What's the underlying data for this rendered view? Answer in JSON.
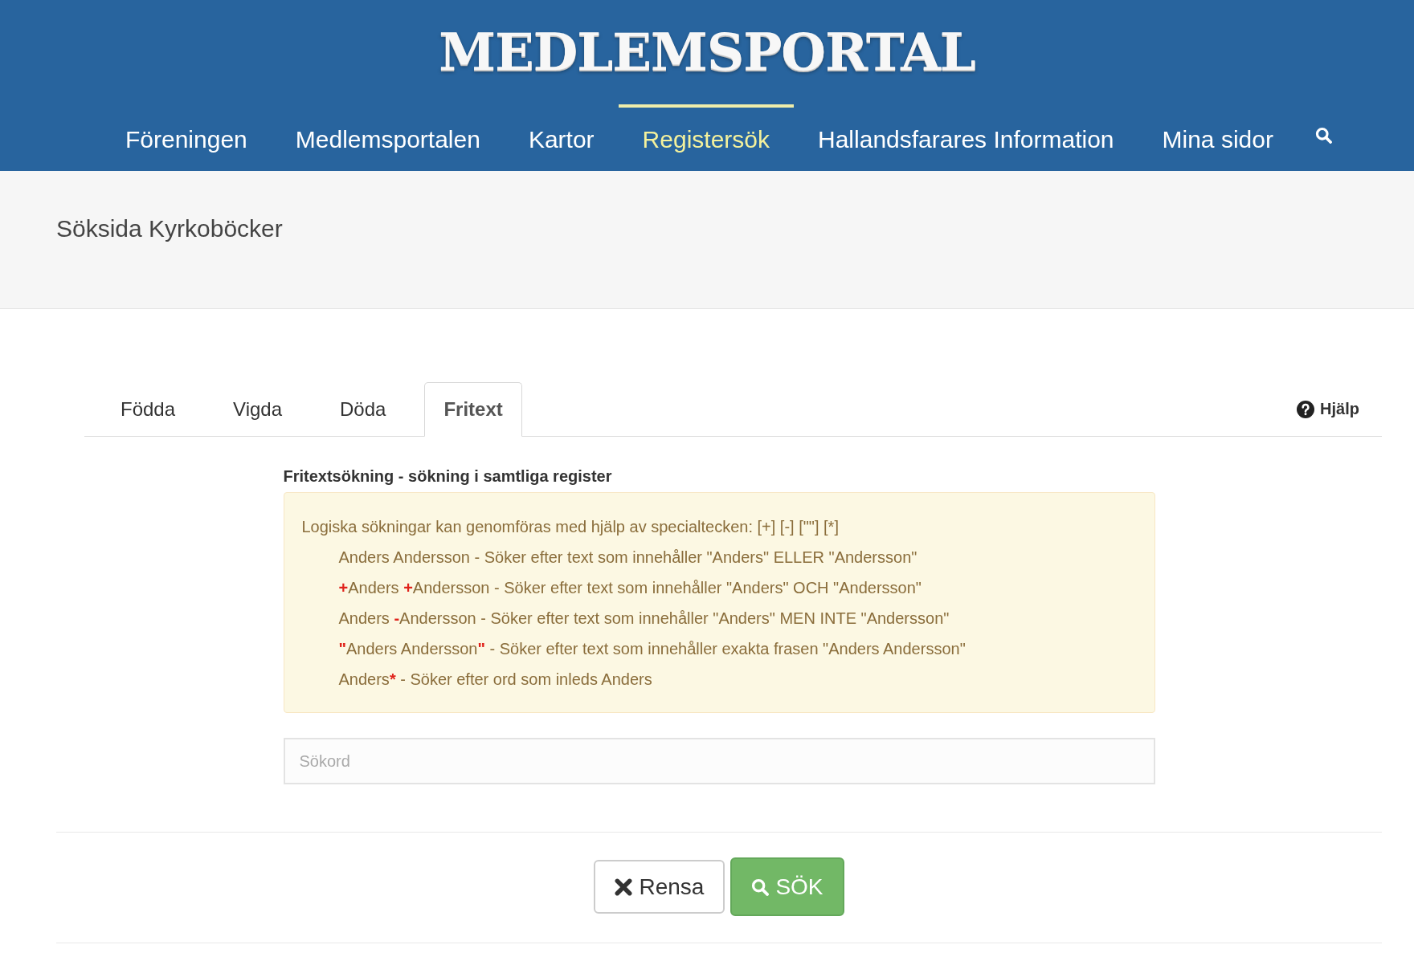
{
  "logo": "MEDLEMSPORTAL",
  "nav": [
    {
      "label": "Föreningen",
      "selected": false
    },
    {
      "label": "Medlemsportalen",
      "selected": false
    },
    {
      "label": "Kartor",
      "selected": false
    },
    {
      "label": "Registersök",
      "selected": true
    },
    {
      "label": "Hallandsfarares Information",
      "selected": false
    },
    {
      "label": "Mina sidor",
      "selected": false
    }
  ],
  "page_title": "Söksida Kyrkoböcker",
  "tabs": [
    {
      "label": "Födda",
      "selected": false
    },
    {
      "label": "Vigda",
      "selected": false
    },
    {
      "label": "Döda",
      "selected": false
    },
    {
      "label": "Fritext",
      "selected": true
    }
  ],
  "help_link": {
    "label": "Hjälp"
  },
  "section_heading": "Fritextsökning - sökning i samtliga register",
  "info_box": {
    "intro": "Logiska sökningar kan genomföras med hjälp av specialtecken: [+] [-] [\"\"] [*]",
    "examples": [
      "Anders Andersson - Söker efter text som innehåller \"Anders\" ELLER \"Andersson\"",
      "**+**Anders **+**Andersson - Söker efter text som innehåller \"Anders\" OCH \"Andersson\"",
      "Anders **-**Andersson - Söker efter text som innehåller \"Anders\" MEN INTE \"Andersson\"",
      "**\"**Anders Andersson**\"** - Söker efter text som innehåller exakta frasen \"Anders Andersson\"",
      "Anders***** - Söker efter ord som inleds Anders"
    ]
  },
  "search_field": {
    "placeholder": "Sökord"
  },
  "buttons": [
    {
      "kind": "reset",
      "label": "Rensa"
    },
    {
      "kind": "search",
      "label": "SÖK"
    }
  ]
}
